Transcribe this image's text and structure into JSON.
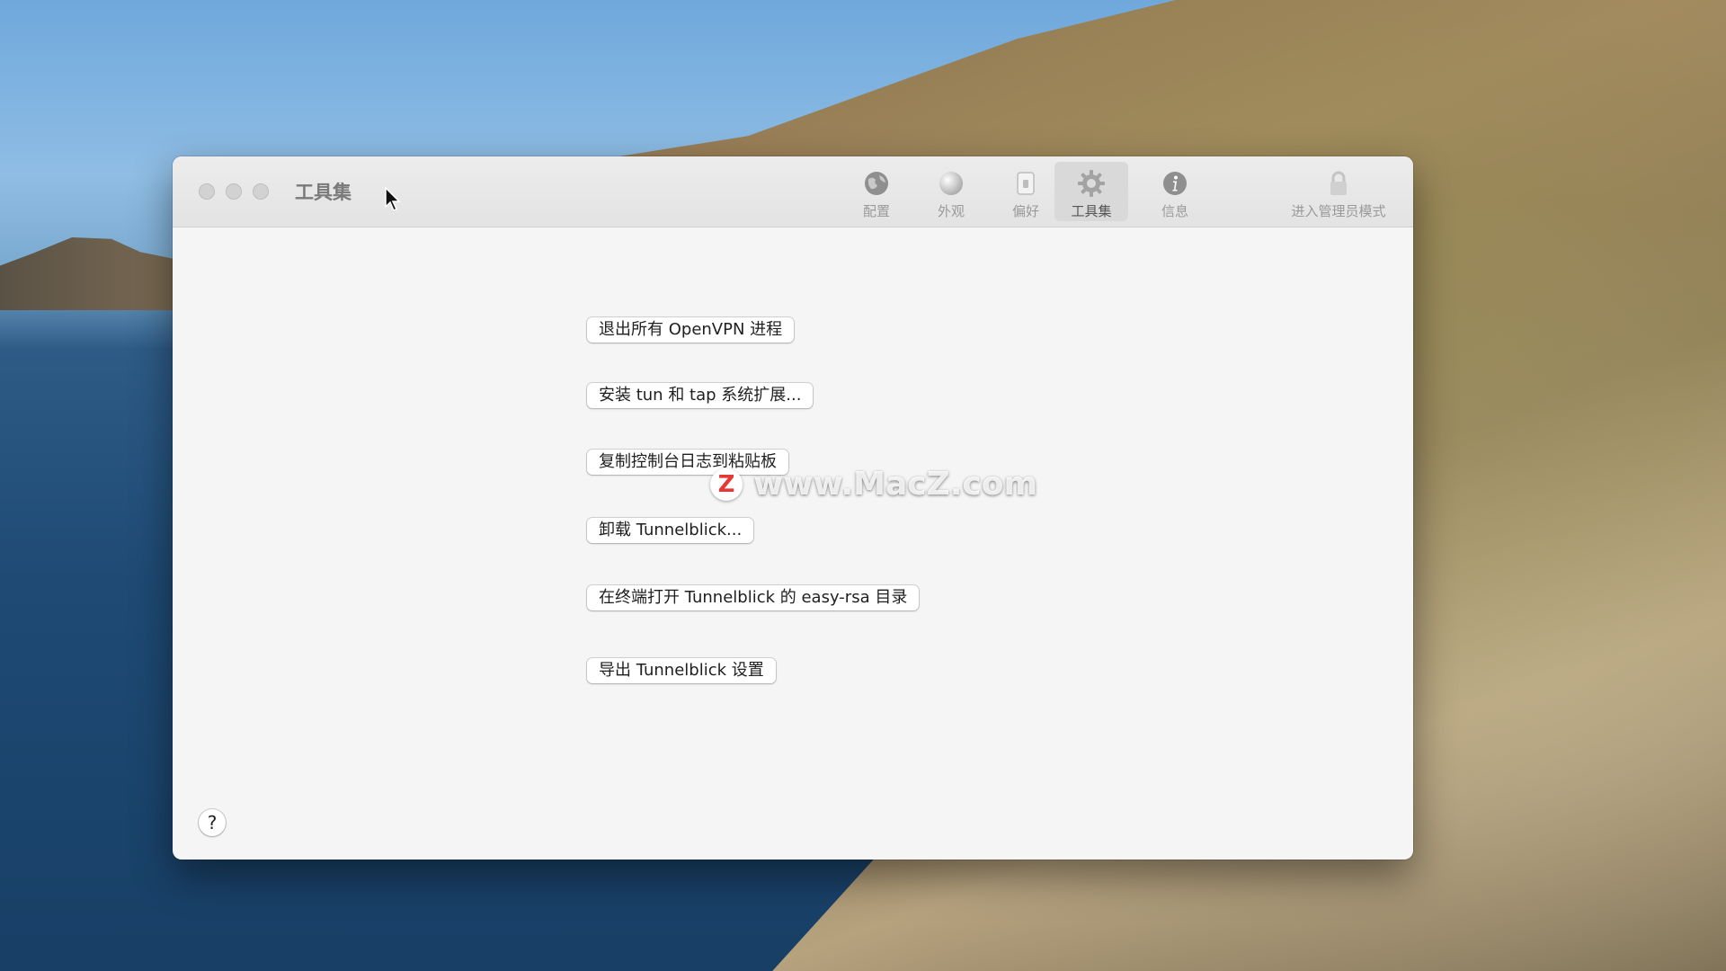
{
  "window": {
    "title": "工具集"
  },
  "toolbar": {
    "items": [
      {
        "label": "配置",
        "icon": "globe-icon"
      },
      {
        "label": "外观",
        "icon": "sphere-icon"
      },
      {
        "label": "偏好",
        "icon": "switch-icon"
      },
      {
        "label": "工具集",
        "icon": "gear-icon",
        "selected": true
      },
      {
        "label": "信息",
        "icon": "info-icon"
      }
    ],
    "admin_label": "进入管理员模式",
    "admin_icon": "lock-icon"
  },
  "buttons": {
    "quit_openvpn": "退出所有 OpenVPN 进程",
    "install_tun_tap": "安装 tun 和 tap 系统扩展...",
    "copy_console_log": "复制控制台日志到粘贴板",
    "uninstall": "卸载 Tunnelblick...",
    "open_easy_rsa": "在终端打开 Tunnelblick 的 easy-rsa 目录",
    "export_settings": "导出 Tunnelblick 设置"
  },
  "help": {
    "label": "?"
  },
  "watermark": {
    "logo_letter": "Z",
    "text": "www.MacZ.com"
  },
  "colors": {
    "window_bg": "#f5f5f5",
    "selected_tab_bg": "#d9d9d9",
    "watermark_logo": "#e53935"
  }
}
